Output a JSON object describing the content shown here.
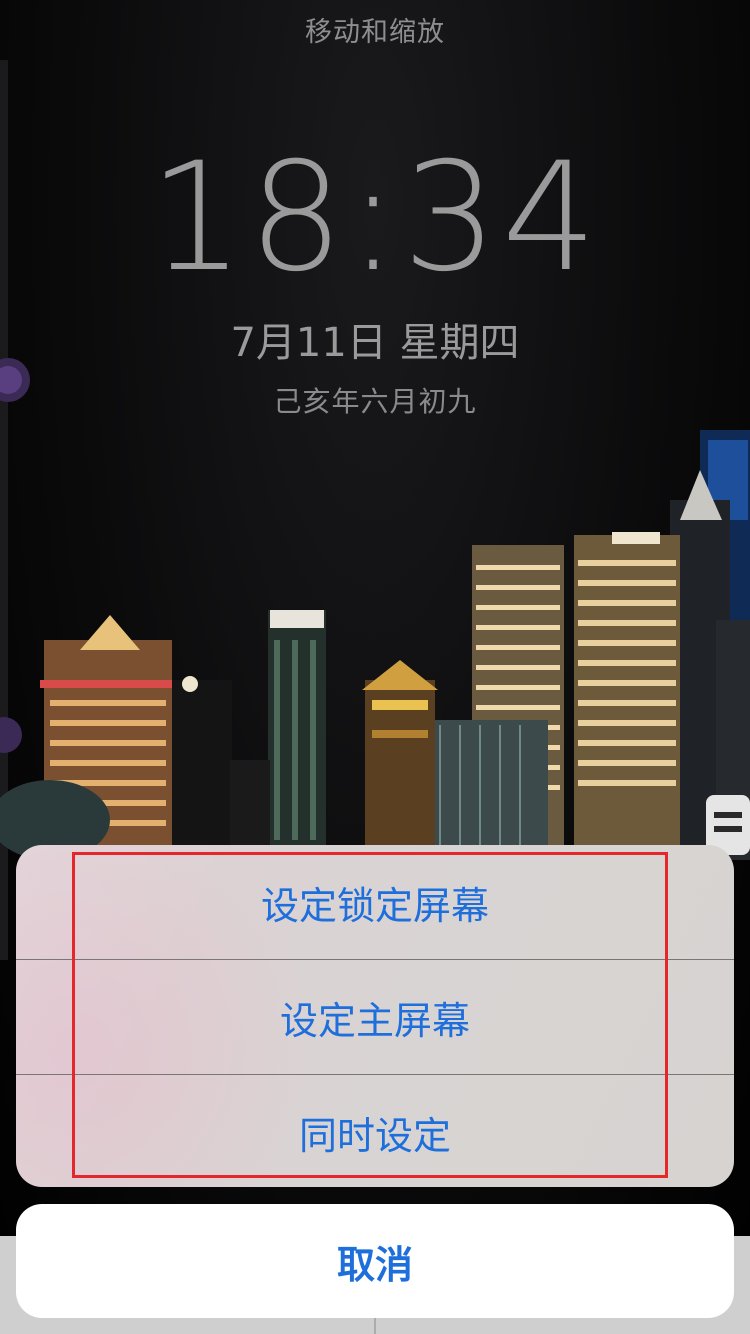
{
  "lock_screen": {
    "caption": "移动和缩放",
    "time": "18:34",
    "date": "7月11日 星期四",
    "lunar_date": "己亥年六月初九"
  },
  "action_sheet": {
    "items": [
      {
        "label": "设定锁定屏幕"
      },
      {
        "label": "设定主屏幕"
      },
      {
        "label": "同时设定"
      }
    ],
    "cancel_label": "取消"
  },
  "colors": {
    "accent": "#1e6fdc",
    "highlight": "#e5262a",
    "sheet_background": "#d8d4d3",
    "cancel_background": "#ffffff"
  }
}
